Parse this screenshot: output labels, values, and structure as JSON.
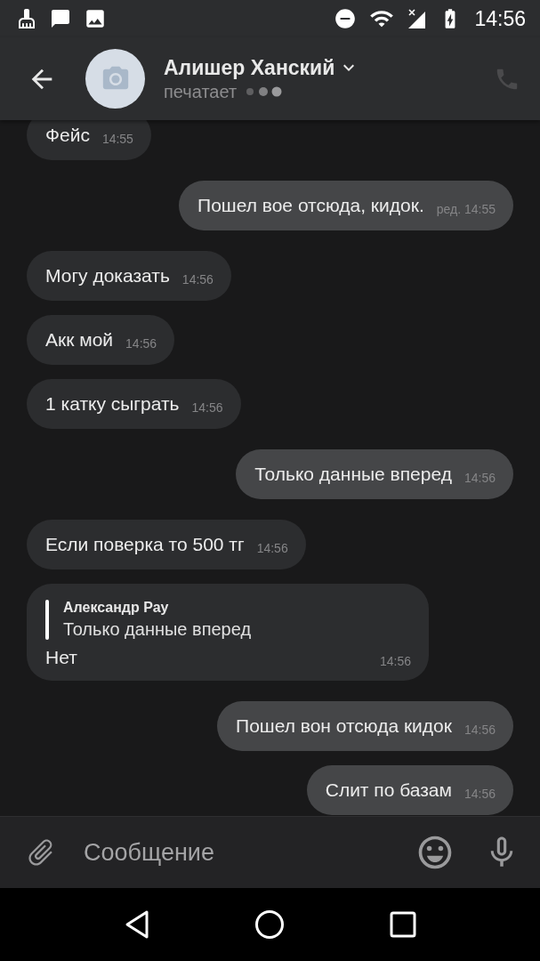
{
  "status_bar": {
    "time": "14:56"
  },
  "header": {
    "name": "Алишер Ханский",
    "status": "печатает"
  },
  "messages": [
    {
      "kind": "incoming",
      "text": "Фейс",
      "time": "14:55"
    },
    {
      "kind": "outgoing",
      "text": "Пошел вое отсюда, кидок.",
      "time": "ред. 14:55"
    },
    {
      "kind": "incoming",
      "text": "Могу доказать",
      "time": "14:56"
    },
    {
      "kind": "incoming",
      "text": "Акк мой",
      "time": "14:56"
    },
    {
      "kind": "incoming",
      "text": "1 катку сыграть",
      "time": "14:56"
    },
    {
      "kind": "outgoing",
      "text": "Только данные вперед",
      "time": "14:56"
    },
    {
      "kind": "incoming",
      "text": "Если поверка то 500 тг",
      "time": "14:56"
    },
    {
      "kind": "incoming",
      "text": "Нет",
      "time": "14:56",
      "quote": {
        "author": "Александр Рау",
        "text": "Только данные вперед"
      }
    },
    {
      "kind": "outgoing",
      "text": "Пошел вон отсюда кидок",
      "time": "14:56"
    },
    {
      "kind": "outgoing",
      "text": "Слит по базам",
      "time": "14:56"
    }
  ],
  "composer": {
    "placeholder": "Сообщение"
  }
}
